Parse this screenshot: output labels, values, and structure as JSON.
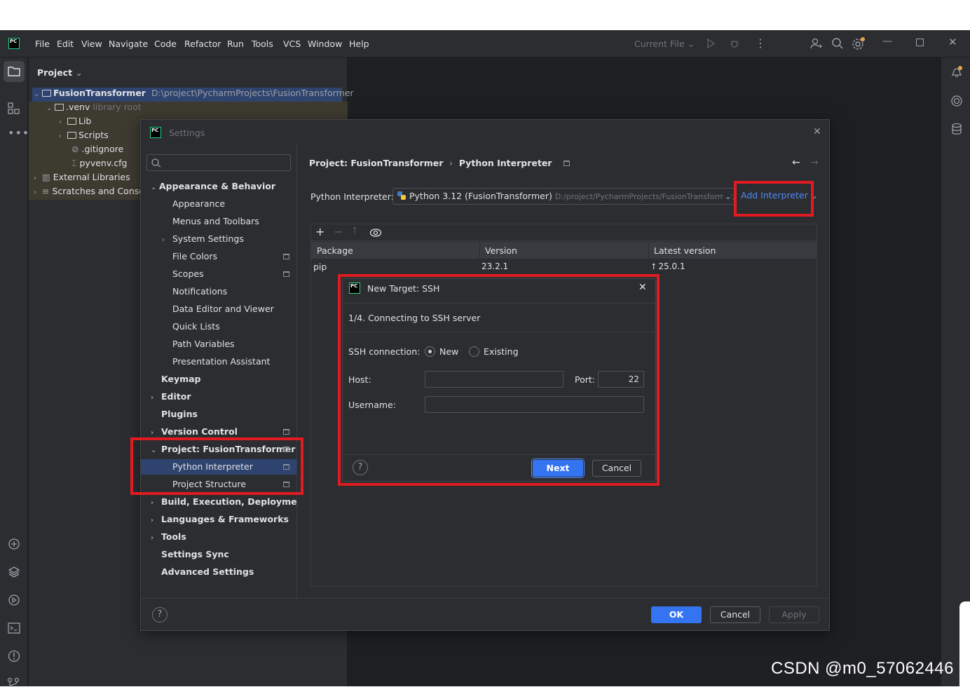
{
  "menu": [
    "File",
    "Edit",
    "View",
    "Navigate",
    "Code",
    "Refactor",
    "Run",
    "Tools",
    "VCS",
    "Window",
    "Help"
  ],
  "toolbar": {
    "run_config": "Current File"
  },
  "project_panel": {
    "title": "Project",
    "root_name": "FusionTransformer",
    "root_path": "D:\\project\\PycharmProjects\\FusionTransformer",
    "items": [
      ".venv",
      "library root",
      "Lib",
      "Scripts",
      ".gitignore",
      "pyvenv.cfg",
      "External Libraries",
      "Scratches and Consoles"
    ]
  },
  "settings": {
    "title": "Settings",
    "search_placeholder": "",
    "nav": [
      "Appearance & Behavior",
      "Appearance",
      "Menus and Toolbars",
      "System Settings",
      "File Colors",
      "Scopes",
      "Notifications",
      "Data Editor and Viewer",
      "Quick Lists",
      "Path Variables",
      "Presentation Assistant",
      "Keymap",
      "Editor",
      "Plugins",
      "Version Control",
      "Project: FusionTransformer",
      "Python Interpreter",
      "Project Structure",
      "Build, Execution, Deployment",
      "Languages & Frameworks",
      "Tools",
      "Settings Sync",
      "Advanced Settings"
    ],
    "breadcrumb": [
      "Project: FusionTransformer",
      "Python Interpreter"
    ],
    "interpreter_label": "Python Interpreter:",
    "interpreter_value": "Python 3.12 (FusionTransformer)",
    "interpreter_path": "D:/project/PycharmProjects/FusionTransformer/",
    "add_interpreter": "Add Interpreter",
    "table": {
      "headers": [
        "Package",
        "Version",
        "Latest version"
      ],
      "rows": [
        [
          "pip",
          "23.2.1",
          "25.0.1"
        ]
      ]
    },
    "buttons": {
      "ok": "OK",
      "cancel": "Cancel",
      "apply": "Apply"
    }
  },
  "ssh_dialog": {
    "title": "New Target: SSH",
    "step": "1/4. Connecting to SSH server",
    "connection_label": "SSH connection:",
    "opt_new": "New",
    "opt_existing": "Existing",
    "host_label": "Host:",
    "host_value": "",
    "port_label": "Port:",
    "port_value": "22",
    "username_label": "Username:",
    "username_value": "",
    "next": "Next",
    "cancel": "Cancel"
  },
  "watermark": "CSDN @m0_57062446"
}
